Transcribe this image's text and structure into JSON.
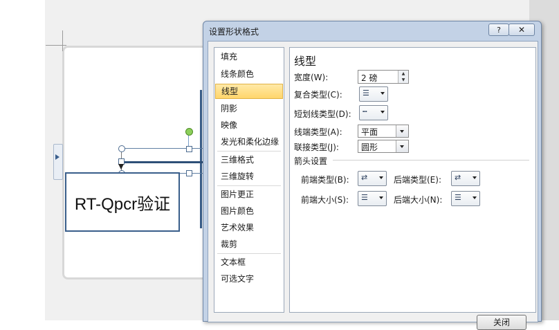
{
  "slide": {
    "shape_text": "RT-Qpcr验证"
  },
  "dialog": {
    "title": "设置形状格式",
    "help_label": "?",
    "close_label": "✕",
    "nav_items": [
      {
        "label": "填充"
      },
      {
        "label": "线条颜色"
      },
      {
        "label": "线型",
        "selected": true
      },
      {
        "label": "阴影"
      },
      {
        "label": "映像"
      },
      {
        "label": "发光和柔化边缘"
      },
      {
        "label": "三维格式"
      },
      {
        "label": "三维旋转"
      },
      {
        "label": "图片更正"
      },
      {
        "label": "图片颜色"
      },
      {
        "label": "艺术效果"
      },
      {
        "label": "裁剪"
      },
      {
        "label": "文本框"
      },
      {
        "label": "可选文字"
      }
    ],
    "panel": {
      "title": "线型",
      "width_label": "宽度(W):",
      "width_value": "2 磅",
      "compound_label": "复合类型(C):",
      "dash_label": "短划线类型(D):",
      "cap_label": "线端类型(A):",
      "cap_value": "平面",
      "join_label": "联接类型(J):",
      "join_value": "圆形",
      "arrow_section": "箭头设置",
      "begin_type_label": "前端类型(B):",
      "end_type_label": "后端类型(E):",
      "begin_size_label": "前端大小(S):",
      "end_size_label": "后端大小(N):"
    },
    "close_button": "关闭"
  }
}
